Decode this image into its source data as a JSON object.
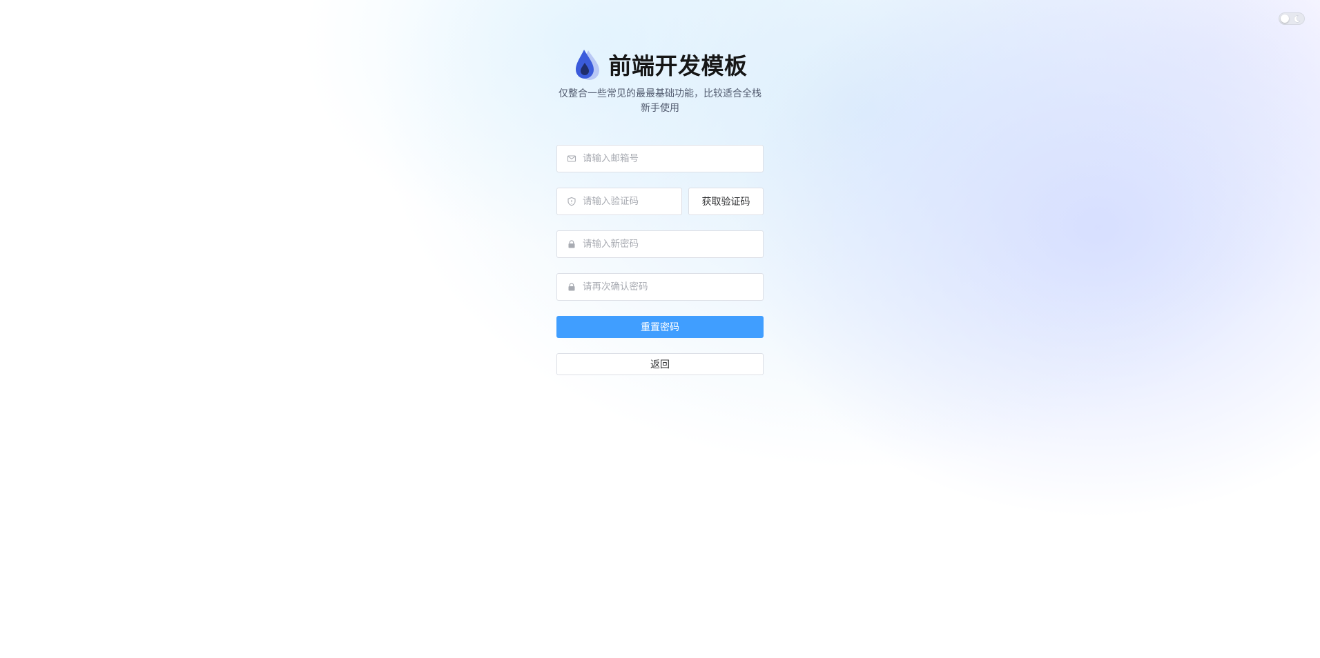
{
  "brand": {
    "title": "前端开发模板",
    "subtitle": "仅整合一些常见的最最基础功能，比较适合全栈新手使用",
    "logo_icon": "water-drop-icon",
    "logo_colors": [
      "#3b5bdb",
      "#b9c8f5",
      "#1f2d6b"
    ]
  },
  "theme_toggle": {
    "icon": "moon-icon"
  },
  "form": {
    "email": {
      "placeholder": "请输入邮箱号",
      "icon": "mail-icon"
    },
    "code": {
      "placeholder": "请输入验证码",
      "icon": "shield-icon"
    },
    "get_code_label": "获取验证码",
    "new_password": {
      "placeholder": "请输入新密码",
      "icon": "lock-icon"
    },
    "confirm_password": {
      "placeholder": "请再次确认密码",
      "icon": "lock-icon"
    },
    "submit_label": "重置密码",
    "back_label": "返回"
  },
  "colors": {
    "primary": "#409eff",
    "border": "#dcdfe6",
    "placeholder": "#a8abb2"
  }
}
